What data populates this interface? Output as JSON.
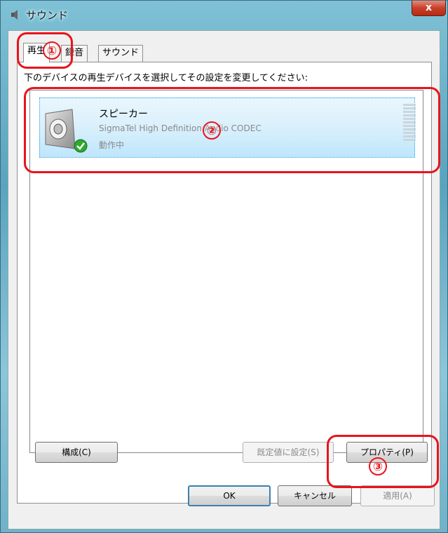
{
  "window": {
    "title": "サウンド",
    "close_label": "x"
  },
  "tabs": [
    {
      "label": "再生"
    },
    {
      "label": "録音"
    },
    {
      "label": "サウンド"
    }
  ],
  "instruction": "下のデバイスの再生デバイスを選択してその設定を変更してください:",
  "device": {
    "name": "スピーカー",
    "description": "SigmaTel High Definition Audio CODEC",
    "status": "動作中",
    "icon": "speaker-icon",
    "status_icon": "check-icon"
  },
  "buttons": {
    "configure": "構成(C)",
    "set_default": "既定値に設定(S)",
    "properties": "プロパティ(P)",
    "ok": "OK",
    "cancel": "キャンセル",
    "apply": "適用(A)"
  },
  "annotations": {
    "one": "①",
    "two": "②",
    "three": "③"
  },
  "colors": {
    "annotation": "#e8141c",
    "selection": "#bee6fd",
    "close": "#c8402a"
  }
}
